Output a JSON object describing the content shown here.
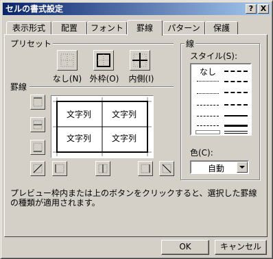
{
  "window": {
    "title": "セルの書式設定",
    "help_label": "?",
    "close_label": "X"
  },
  "tabs": [
    {
      "label": "表示形式",
      "active": false
    },
    {
      "label": "配置",
      "active": false
    },
    {
      "label": "フォント",
      "active": false
    },
    {
      "label": "罫線",
      "active": true
    },
    {
      "label": "パターン",
      "active": false
    },
    {
      "label": "保護",
      "active": false
    }
  ],
  "preset": {
    "group_label": "プリセット",
    "none_label": "なし(N)",
    "outline_label": "外枠(O)",
    "inside_label": "内側(I)"
  },
  "border": {
    "group_label": "罫線"
  },
  "preview": {
    "cells": [
      "文字列",
      "文字列",
      "文字列",
      "文字列"
    ]
  },
  "line": {
    "group_label": "線",
    "style_label": "スタイル(S):",
    "none_label": "なし"
  },
  "color": {
    "label": "色(C):",
    "value": "自動"
  },
  "hint": "プレビュー枠内または上のボタンをクリックすると、選択した罫線の種類が適用されます。",
  "buttons": {
    "ok": "OK",
    "cancel": "キャンセル"
  },
  "colors": {
    "title_start": "#0a246a",
    "title_end": "#a6caf0",
    "face": "#d4d0c8"
  }
}
